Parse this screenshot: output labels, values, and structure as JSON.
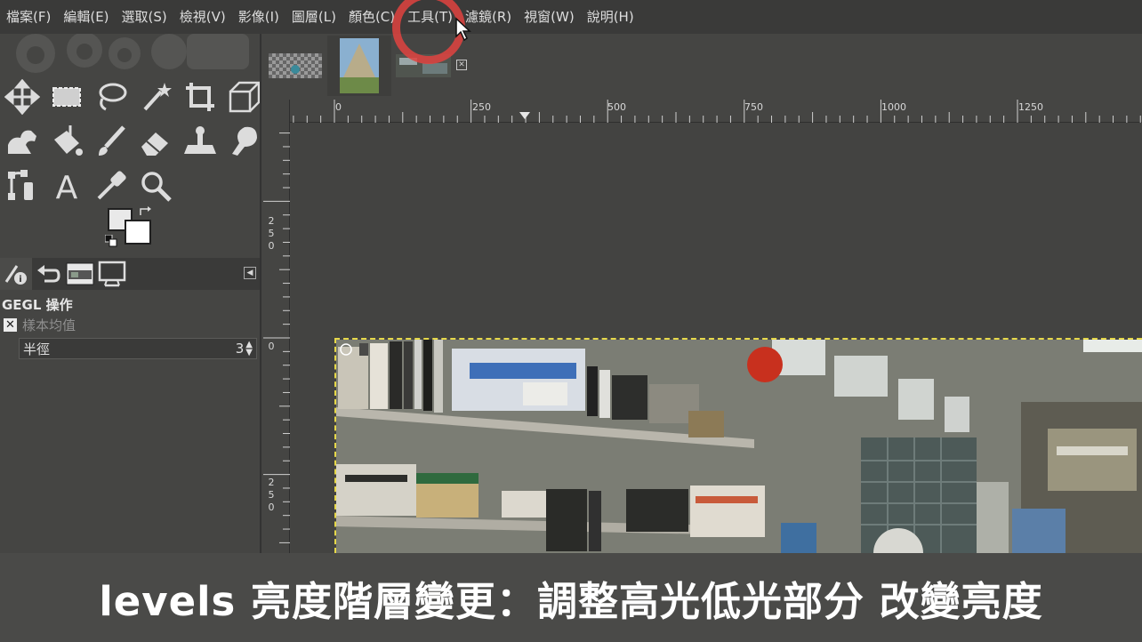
{
  "menubar": {
    "items": [
      "檔案(F)",
      "編輯(E)",
      "選取(S)",
      "檢視(V)",
      "影像(I)",
      "圖層(L)",
      "顏色(C)",
      "工具(T)",
      "濾鏡(R)",
      "視窗(W)",
      "說明(H)"
    ]
  },
  "toolbox": {
    "tools": [
      "move-icon",
      "rect-select-icon",
      "lasso-icon",
      "fuzzy-select-icon",
      "crop-icon",
      "perspective-icon",
      "warp-icon",
      "bucket-fill-icon",
      "paintbrush-icon",
      "eraser-icon",
      "clone-icon",
      "smudge-icon",
      "paths-icon",
      "text-icon",
      "color-picker-icon",
      "zoom-icon"
    ]
  },
  "gegl_panel": {
    "title": "GEGL 操作",
    "operation": "樣本均值",
    "radius_label": "半徑",
    "radius_value": "3"
  },
  "ruler": {
    "top_labels": [
      "0",
      "250",
      "500",
      "750",
      "1000",
      "1250"
    ],
    "left_labels": [
      "2",
      "5",
      "0",
      "0",
      "2",
      "5",
      "0"
    ]
  },
  "caption": {
    "text": "levels 亮度階層變更：調整高光低光部分  改變亮度"
  },
  "colors": {
    "accent_ring": "#e0433f",
    "selection_dash": "#e6d84a"
  }
}
